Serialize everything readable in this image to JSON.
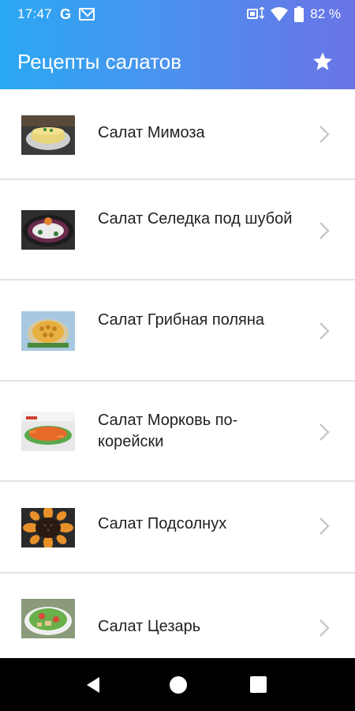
{
  "status_bar": {
    "time": "17:47",
    "battery": "82 %",
    "icons": [
      "google-icon",
      "gmail-icon",
      "data-saver-icon",
      "wifi-icon",
      "battery-icon"
    ]
  },
  "app_bar": {
    "title": "Рецепты салатов",
    "action_icon": "star-icon"
  },
  "list": {
    "items": [
      {
        "label": "Салат Мимоза",
        "thumb": "mimosa-salad-photo"
      },
      {
        "label": "Салат Селедка под шубой",
        "thumb": "herring-salad-photo"
      },
      {
        "label": "Салат Грибная поляна",
        "thumb": "mushroom-salad-photo"
      },
      {
        "label": "Салат Морковь по-корейски",
        "thumb": "korean-carrot-photo"
      },
      {
        "label": "Салат Подсолнух",
        "thumb": "sunflower-salad-photo"
      },
      {
        "label": "Салат Цезарь",
        "thumb": "caesar-salad-photo"
      }
    ]
  },
  "nav_bar": {
    "icons": [
      "back-icon",
      "home-icon",
      "recents-icon"
    ]
  },
  "colors": {
    "header_gradient_start": "#2aa8f2",
    "header_gradient_end": "#6a73e6",
    "divider": "#e2e2e2",
    "chevron": "#c8c8c8"
  }
}
